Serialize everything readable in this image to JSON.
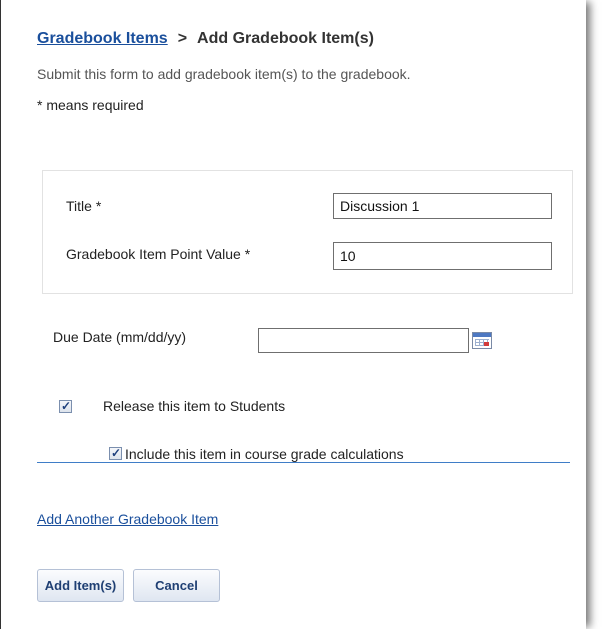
{
  "breadcrumb": {
    "parent_label": "Gradebook Items",
    "separator": ">",
    "current_label": "Add Gradebook Item(s)"
  },
  "instructions": "Submit this form to add gradebook item(s) to the gradebook.",
  "required_note": "* means required",
  "form": {
    "title_label": "Title *",
    "title_value": "Discussion 1",
    "points_label": "Gradebook Item Point Value *",
    "points_value": "10",
    "due_date_label": "Due Date (mm/dd/yy)",
    "due_date_value": "",
    "calendar_icon": "calendar-icon",
    "release_label": "Release this item to Students",
    "release_checked": true,
    "include_label": "Include this item in course grade calculations",
    "include_checked": true
  },
  "add_another_link": "Add Another Gradebook Item",
  "buttons": {
    "add_label": "Add Item(s)",
    "cancel_label": "Cancel"
  },
  "colors": {
    "link": "#1a4f9c",
    "divider": "#3f7dc7",
    "button_text": "#1f3f73"
  }
}
